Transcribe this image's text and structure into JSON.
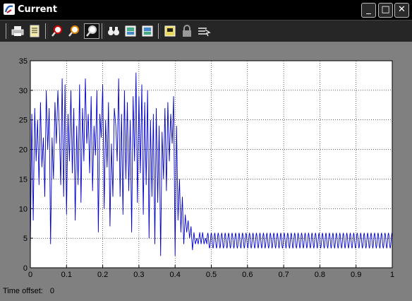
{
  "window": {
    "title": "Current"
  },
  "title_buttons": {
    "minimize": "_",
    "maximize": "□",
    "close": "✕"
  },
  "toolbar": {
    "items": [
      {
        "name": "print-icon",
        "glyph": "⎙"
      },
      {
        "name": "parameters-icon",
        "glyph": "▤"
      },
      {
        "name": "zoom-in-icon",
        "glyph": "⚲"
      },
      {
        "name": "zoom-x-icon",
        "glyph": "⚲"
      },
      {
        "name": "zoom-y-icon",
        "glyph": "⚲"
      },
      {
        "name": "autoscale-binoculars-icon",
        "glyph": "⛶"
      },
      {
        "name": "save-axes-icon",
        "glyph": "▣"
      },
      {
        "name": "restore-axes-icon",
        "glyph": "▣"
      },
      {
        "name": "floating-scope-icon",
        "glyph": "▭"
      },
      {
        "name": "lock-axes-icon",
        "glyph": "🔒"
      },
      {
        "name": "signal-selection-icon",
        "glyph": "⇶"
      }
    ]
  },
  "status": {
    "label": "Time offset:",
    "value": "0"
  },
  "colors": {
    "line": "#0000cc",
    "axes_bg": "#ffffff",
    "figure_bg": "#808080",
    "grid": "#000000"
  },
  "chart_data": {
    "type": "line",
    "title": "",
    "xlabel": "",
    "ylabel": "",
    "xlim": [
      0,
      1
    ],
    "ylim": [
      0,
      35
    ],
    "xticks": [
      "0",
      "0.1",
      "0.2",
      "0.3",
      "0.4",
      "0.5",
      "0.6",
      "0.7",
      "0.8",
      "0.9",
      "1"
    ],
    "yticks": [
      "0",
      "5",
      "10",
      "15",
      "20",
      "25",
      "30",
      "35"
    ],
    "grid": true,
    "series": [
      {
        "name": "",
        "x": [
          0,
          0.004,
          0.008,
          0.012,
          0.016,
          0.02,
          0.024,
          0.028,
          0.032,
          0.036,
          0.04,
          0.044,
          0.048,
          0.052,
          0.056,
          0.06,
          0.064,
          0.068,
          0.072,
          0.076,
          0.08,
          0.084,
          0.088,
          0.092,
          0.096,
          0.1,
          0.104,
          0.108,
          0.112,
          0.116,
          0.12,
          0.124,
          0.128,
          0.132,
          0.136,
          0.14,
          0.144,
          0.148,
          0.152,
          0.156,
          0.16,
          0.164,
          0.168,
          0.172,
          0.176,
          0.18,
          0.184,
          0.188,
          0.192,
          0.196,
          0.2,
          0.204,
          0.208,
          0.212,
          0.216,
          0.22,
          0.224,
          0.228,
          0.232,
          0.236,
          0.24,
          0.244,
          0.248,
          0.252,
          0.256,
          0.26,
          0.264,
          0.268,
          0.272,
          0.276,
          0.28,
          0.284,
          0.288,
          0.292,
          0.296,
          0.3,
          0.304,
          0.308,
          0.312,
          0.316,
          0.32,
          0.324,
          0.328,
          0.332,
          0.336,
          0.34,
          0.344,
          0.348,
          0.352,
          0.356,
          0.36,
          0.364,
          0.368,
          0.372,
          0.376,
          0.38,
          0.384,
          0.388,
          0.392,
          0.396,
          0.4,
          0.404,
          0.408,
          0.412,
          0.416,
          0.42,
          0.424,
          0.428,
          0.432,
          0.436,
          0.44,
          0.444,
          0.448,
          0.452,
          0.456,
          0.46,
          0.464,
          0.468,
          0.472,
          0.476,
          0.48,
          0.484,
          0.488
        ],
        "y": [
          3,
          26,
          8,
          27,
          18,
          25,
          14,
          28,
          17,
          22,
          12,
          30,
          20,
          27,
          4,
          22,
          15,
          28,
          21,
          30,
          24,
          14,
          32,
          12,
          31,
          9,
          26,
          18,
          30,
          16,
          27,
          8,
          24,
          14,
          31,
          11,
          27,
          18,
          32,
          21,
          26,
          16,
          29,
          13,
          24,
          19,
          30,
          6,
          26,
          22,
          31,
          10,
          25,
          17,
          28,
          7,
          21,
          12,
          27,
          24,
          18,
          32,
          12,
          26,
          9,
          30,
          15,
          28,
          13,
          25,
          6,
          29,
          18,
          33,
          11,
          29,
          16,
          31,
          9,
          28,
          14,
          30,
          5,
          25,
          12,
          26,
          4,
          27,
          11,
          24,
          2,
          23,
          15,
          27,
          13,
          28,
          18,
          26,
          21,
          29,
          2,
          24,
          8,
          15,
          6,
          12,
          4,
          9,
          6,
          8,
          5,
          7,
          3,
          6,
          4,
          5,
          4,
          6,
          4,
          6,
          4,
          5,
          4
        ],
        "steady_state": {
          "x_start": 0.488,
          "x_end": 1.0,
          "mean": 4.6,
          "amplitude": 1.3,
          "period": 0.0096
        }
      }
    ]
  }
}
